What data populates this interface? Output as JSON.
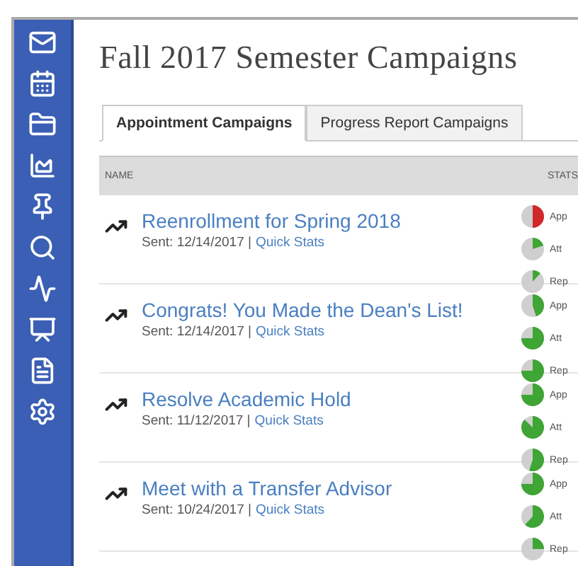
{
  "sidebar": {
    "items": [
      {
        "kind": "mail"
      },
      {
        "kind": "calendar"
      },
      {
        "kind": "folder"
      },
      {
        "kind": "chart"
      },
      {
        "kind": "pin"
      },
      {
        "kind": "search"
      },
      {
        "kind": "pulse"
      },
      {
        "kind": "presentation"
      },
      {
        "kind": "document"
      },
      {
        "kind": "settings"
      }
    ]
  },
  "title": "Fall 2017 Semester Campaigns",
  "tabs": [
    {
      "label": "Appointment Campaigns",
      "selected": true
    },
    {
      "label": "Progress Report Campaigns",
      "selected": false
    }
  ],
  "table": {
    "columns": [
      "NAME",
      "STATS"
    ],
    "rows": [
      {
        "name": "Reenrollment for Spring 2018",
        "sent": "Sent: 12/14/2017 |",
        "link": "Quick Stats",
        "stats": [
          {
            "label": "App",
            "color": "#d0282a"
          },
          {
            "label": "Att",
            "color": "#3fa535"
          },
          {
            "label": "Rep",
            "color": "#3fa535"
          }
        ]
      },
      {
        "name": "Congrats! You Made the Dean's List!",
        "sent": "Sent: 12/14/2017 |",
        "link": "Quick Stats",
        "stats": [
          {
            "label": "App",
            "color": "#3fa535"
          },
          {
            "label": "Att",
            "color": "#3fa535"
          },
          {
            "label": "Rep",
            "color": "#3fa535"
          }
        ]
      },
      {
        "name": "Resolve Academic Hold",
        "sent": "Sent: 11/12/2017 |",
        "link": "Quick Stats",
        "stats": [
          {
            "label": "App",
            "color": "#3fa535"
          },
          {
            "label": "Att",
            "color": "#3fa535"
          },
          {
            "label": "Rep",
            "color": "#3fa535"
          }
        ]
      },
      {
        "name": "Meet with a Transfer Advisor",
        "sent": "Sent: 10/24/2017 |",
        "link": "Quick Stats",
        "stats": [
          {
            "label": "App",
            "color": "#3fa535"
          },
          {
            "label": "Att",
            "color": "#3fa535"
          },
          {
            "label": "Rep",
            "color": "#3fa535"
          }
        ]
      }
    ]
  }
}
